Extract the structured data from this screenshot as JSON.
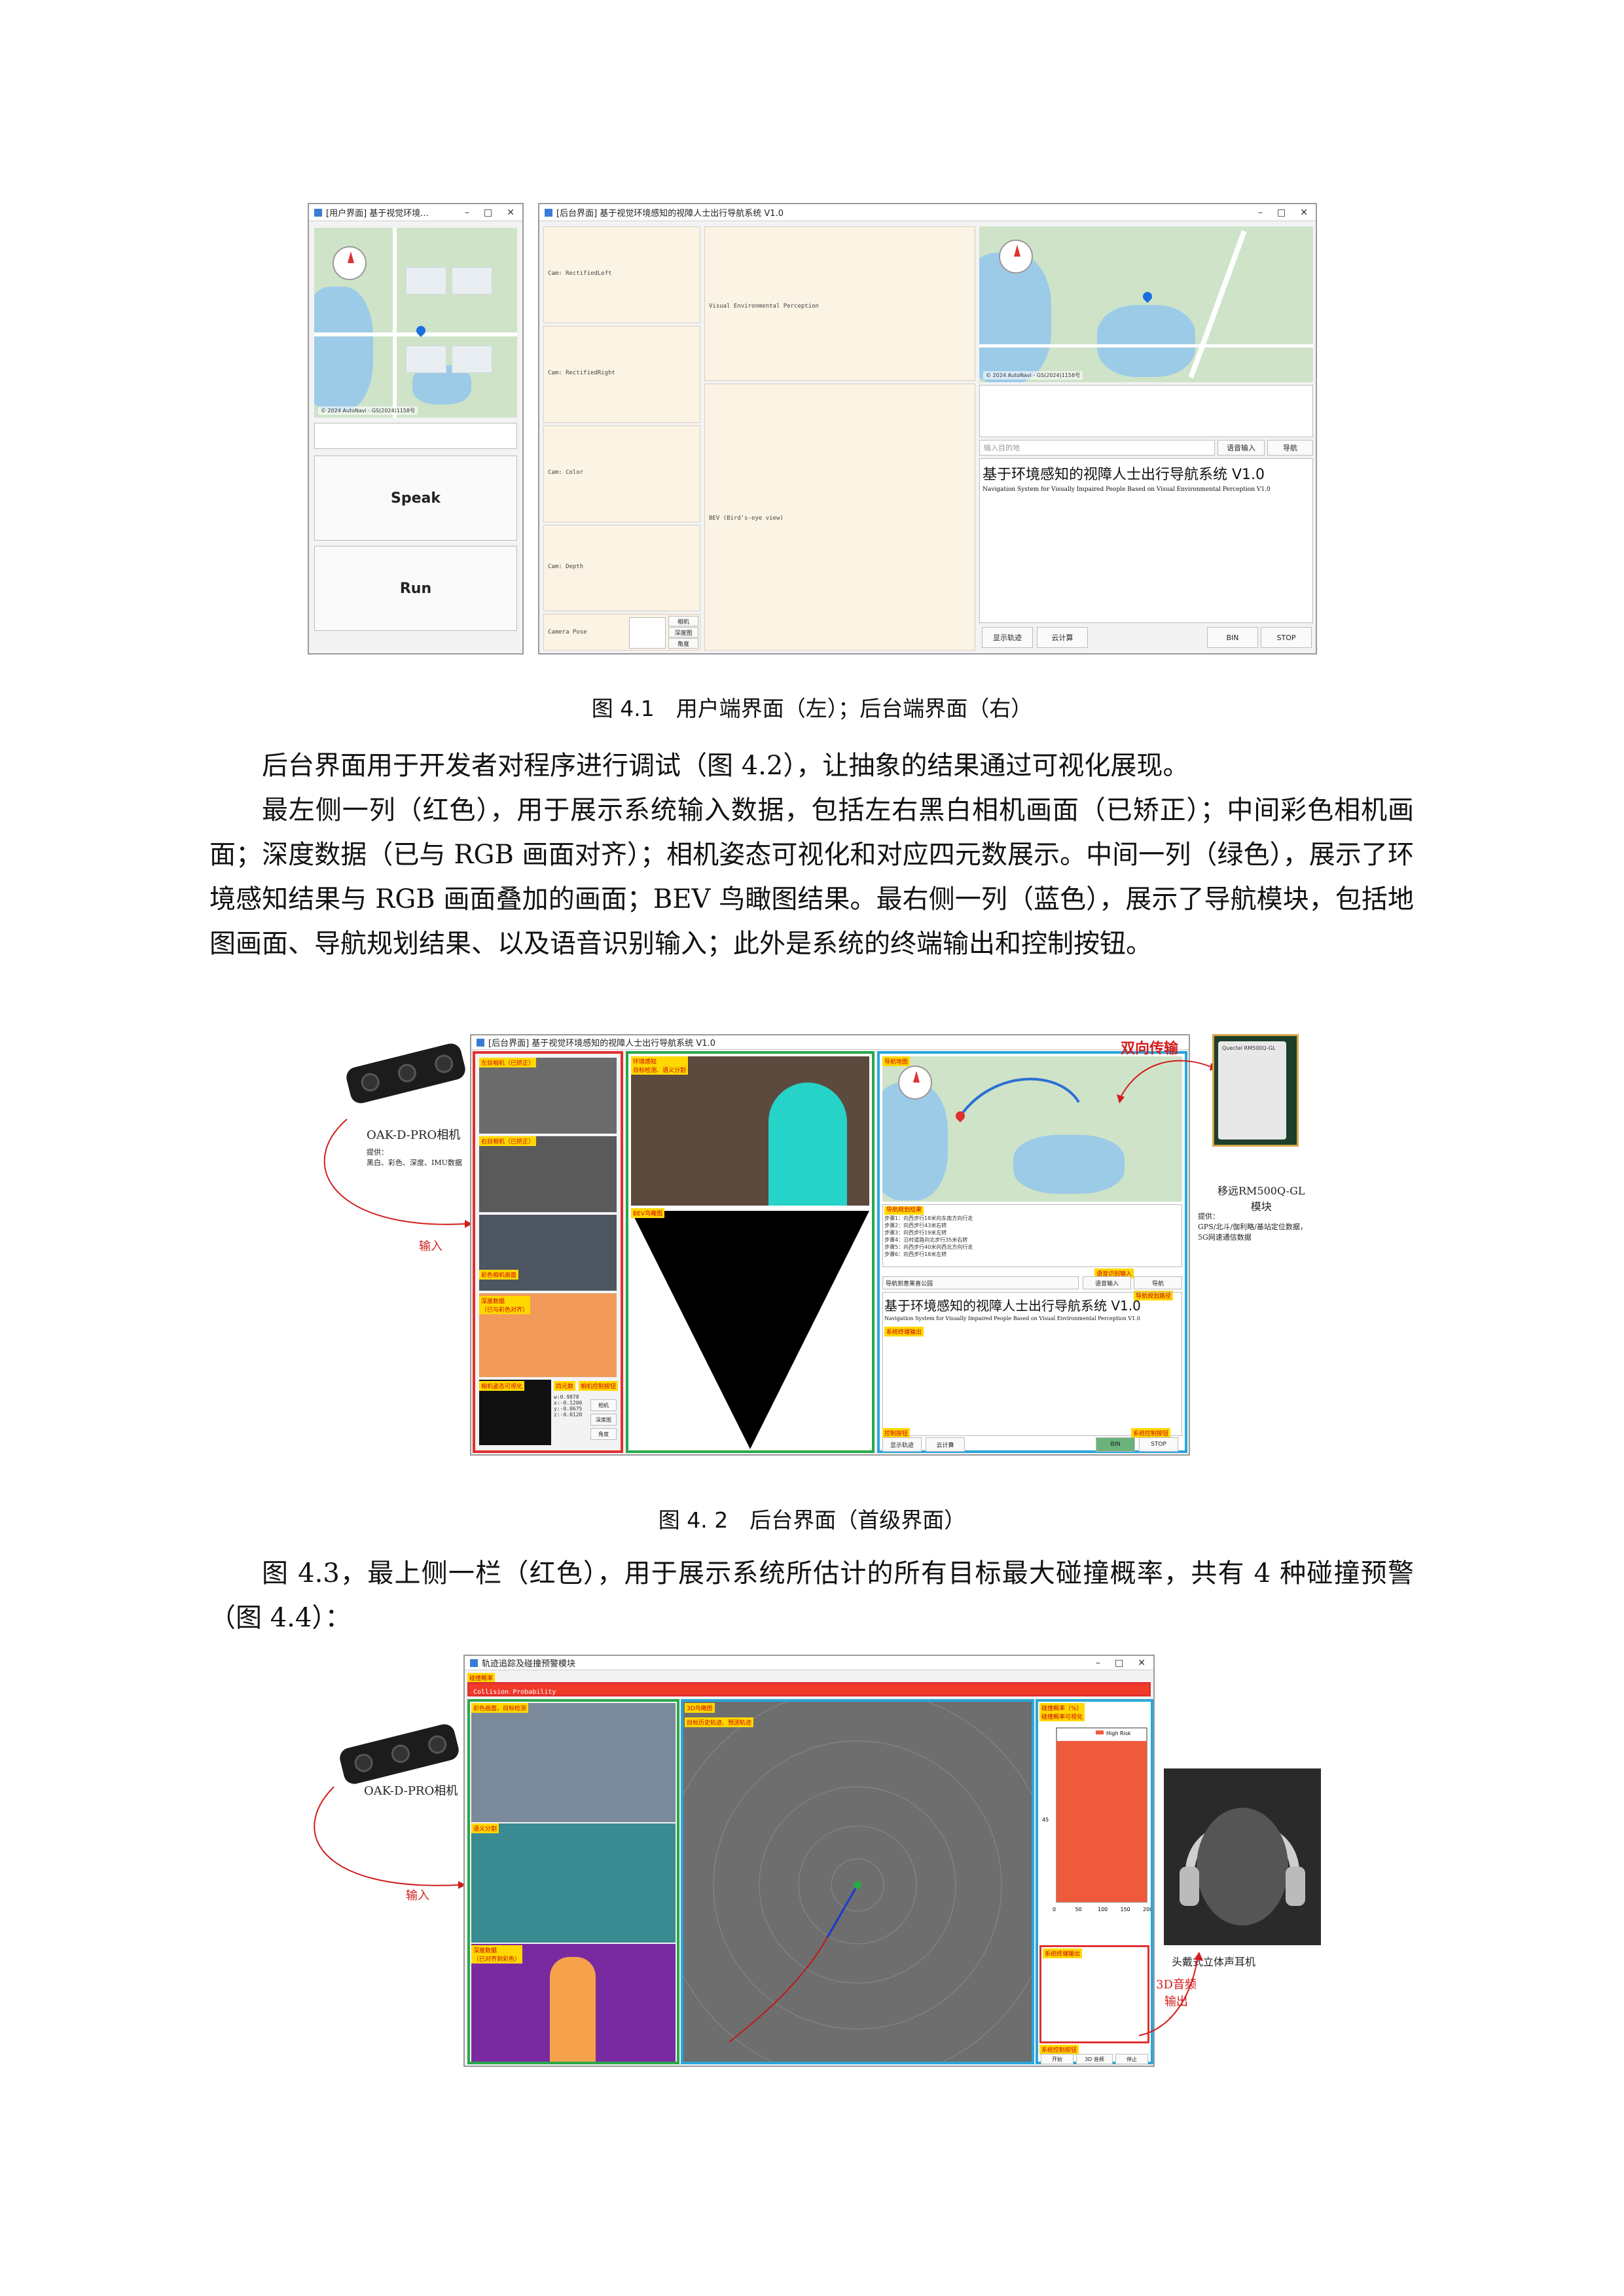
{
  "figure1": {
    "user_window_title": "[用户界面] 基于视觉环境...",
    "admin_window_title": "[后台界面] 基于视觉环境感知的视障人士出行导航系统 V1.0",
    "map_attribution": "© 2024 AutoNavi - GS(2024)1158号",
    "speak_button": "Speak",
    "run_button": "Run",
    "cam_labels": [
      "Cam: RectifiedLeft",
      "Cam: RectifiedRight",
      "Cam: Color",
      "Cam: Depth",
      "Camera Pose"
    ],
    "pose_buttons": [
      "相机",
      "深度图",
      "角度"
    ],
    "visual_label": "Visual Environmental Perception",
    "bev_label": "BEV (Bird's-eye view)",
    "search_placeholder": "输入目的地",
    "voice_input_button": "语音输入",
    "navigate_button": "导航",
    "system_title_cn": "基于环境感知的视障人士出行导航系统 V1.0",
    "system_title_en": "Navigation System for Visually Impaired People Based on Visual Environmental Perception V1.0",
    "bottom_buttons": [
      "显示轨迹",
      "云计算",
      "BIN",
      "STOP"
    ],
    "caption": "图 4.1　用户端界面（左）；后台端界面（右）"
  },
  "paragraphs": [
    "后台界面用于开发者对程序进行调试（图 4.2），让抽象的结果通过可视化展现。",
    "最左侧一列（红色），用于展示系统输入数据，包括左右黑白相机画面（已矫正）；中间彩色相机画面；深度数据（已与 RGB 画面对齐）；相机姿态可视化和对应四元数展示。中间一列（绿色），展示了环境感知结果与 RGB 画面叠加的画面；BEV 鸟瞰图结果。最右侧一列（蓝色），展示了导航模块，包括地图画面、导航规划结果、以及语音识别输入；此外是系统的终端输出和控制按钮。"
  ],
  "figure2": {
    "window_title": "[后台界面] 基于视觉环境感知的视障人士出行导航系统 V1.0",
    "camera_name": "OAK-D-PRO相机",
    "camera_provides": "提供：\n黑白、彩色、深度、IMU数据",
    "input_note": "输入",
    "bidirectional_note": "双向传输",
    "module_name": "移远RM500Q-GL\n模块",
    "module_provides": "提供：\nGPS/北斗/伽利略/基站定位数据，5G网速通信数据",
    "module_chip_text": "Quectel  RM500Q-GL",
    "left_labels": [
      "左目相机（已矫正）",
      "右目相机（已矫正）",
      "彩色相机画面",
      "深度数据\n（已与彩色对齐）",
      "相机姿态可视化",
      "四元数",
      "相机控制按钮"
    ],
    "quat_text": "w:0.9878\nx:-0.1200\ny:-0.0675\nz:-0.0120",
    "mid_labels": [
      "环境感知\n目标检测、语义分割",
      "BEV鸟瞰图"
    ],
    "right_labels": [
      "导航地图",
      "导航规划结果",
      "语音识别输入",
      "系统终端输出",
      "控制按钮",
      "系统控制按钮",
      "导航规划路径"
    ],
    "nav_steps": [
      "步骤1：向西步行18米向东南方向行走",
      "步骤2：向西步行43米右转",
      "步骤3：向西步行19米左转",
      "步骤4：沿村道路向北步行35米右转",
      "步骤5：向西步行40米向西北方向行走",
      "步骤6：向西步行18米左转",
      "步骤7：向西步行154米右转",
      "步骤8：向东步行200米到达目的地"
    ],
    "destination_value": "导航到意莱喜公园",
    "voice_input_button": "语音输入",
    "navigate_button": "导航",
    "system_title_cn": "基于环境感知的视障人士出行导航系统 V1.0",
    "system_title_en": "Navigation System for Visually Impaired People Based on Visual Environmental Perception V1.0",
    "bottom_buttons": [
      "显示轨迹",
      "云计算",
      "BIN",
      "STOP"
    ],
    "pose_buttons": [
      "相机",
      "深度图",
      "角度"
    ],
    "caption": "图 4. 2　后台界面（首级界面）"
  },
  "paragraph3": "图 4.3，最上侧一栏（红色），用于展示系统所估计的所有目标最大碰撞概率，共有 4 种碰撞预警（图 4.4）：",
  "figure3": {
    "window_title": "轨迹追踪及碰撞预警模块",
    "top_label": "碰撞概率",
    "top_bar_text": "Collision Probability",
    "camera_name": "OAK-D-PRO相机",
    "input_note": "输入",
    "left_labels": [
      "彩色画面，目标检测",
      "语义分割",
      "深度数据\n（已对齐到彩色）"
    ],
    "mid_labels": [
      "3D鸟瞰图",
      "目标历史轨迹、预测轨迹"
    ],
    "right_labels": [
      "碰撞概率（%）\n碰撞概率可视化",
      "系统终端输出",
      "系统控制按钮"
    ],
    "legend_high_risk": "High Risk",
    "y_tick": "45",
    "x_ticks": [
      "0",
      "50",
      "100",
      "150",
      "200"
    ],
    "bottom_buttons": [
      "开始",
      "3D 音频",
      "停止"
    ],
    "headphone_label": "头戴式立体声耳机",
    "audio_note": "3D音频\n输出"
  },
  "chart_data": {
    "type": "bar",
    "categories": [
      "45"
    ],
    "series": [
      {
        "name": "High Risk",
        "values": [
          200
        ]
      }
    ],
    "xlim": [
      0,
      200
    ],
    "x_ticks": [
      "0",
      "50",
      "100",
      "150",
      "200"
    ],
    "orientation": "horizontal",
    "colors": [
      "#f05a3c"
    ]
  }
}
